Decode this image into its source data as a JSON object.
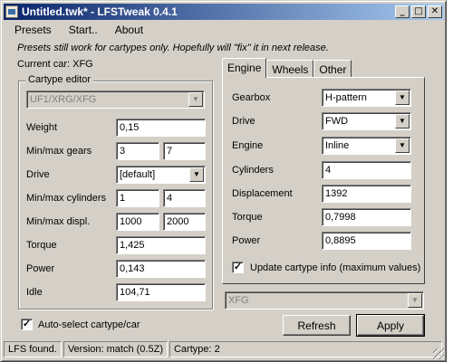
{
  "window": {
    "title": "Untitled.twk* - LFSTweak 0.4.1",
    "min_glyph": "_",
    "max_glyph": "□",
    "close_glyph": "✕"
  },
  "menu": [
    "Presets",
    "Start..",
    "About"
  ],
  "notice": "Presets still work for cartypes only. Hopefully will \"fix\" it in next release.",
  "current_car": "Current car: XFG",
  "editor": {
    "title": "Cartype editor",
    "cartype": "UF1/XRG/XFG",
    "weight_label": "Weight",
    "weight": "0,15",
    "gears_label": "Min/max gears",
    "gears_min": "3",
    "gears_max": "7",
    "drive_label": "Drive",
    "drive": "[default]",
    "cyl_label": "Min/max cylinders",
    "cyl_min": "1",
    "cyl_max": "4",
    "displ_label": "Min/max displ.",
    "displ_min": "1000",
    "displ_max": "2000",
    "torque_label": "Torque",
    "torque": "1,425",
    "power_label": "Power",
    "power": "0,143",
    "idle_label": "Idle",
    "idle": "104,71"
  },
  "tabs": [
    "Engine",
    "Wheels",
    "Other"
  ],
  "engine": {
    "gearbox_label": "Gearbox",
    "gearbox": "H-pattern",
    "drive_label": "Drive",
    "drive": "FWD",
    "engine_label": "Engine",
    "engine": "Inline",
    "cylinders_label": "Cylinders",
    "cylinders": "4",
    "displacement_label": "Displacement",
    "displacement": "1392",
    "torque_label": "Torque",
    "torque": "0,7998",
    "power_label": "Power",
    "power": "0,8895",
    "update_label": "Update cartype info (maximum values)",
    "update_checked": true
  },
  "car_select": "XFG",
  "auto_select_label": "Auto-select cartype/car",
  "auto_select_checked": true,
  "buttons": {
    "refresh": "Refresh",
    "apply": "Apply"
  },
  "status": [
    "LFS found.",
    "Version: match (0.5Z)",
    "Cartype: 2"
  ],
  "check_glyph": "✓",
  "arrow_glyph": "▼"
}
